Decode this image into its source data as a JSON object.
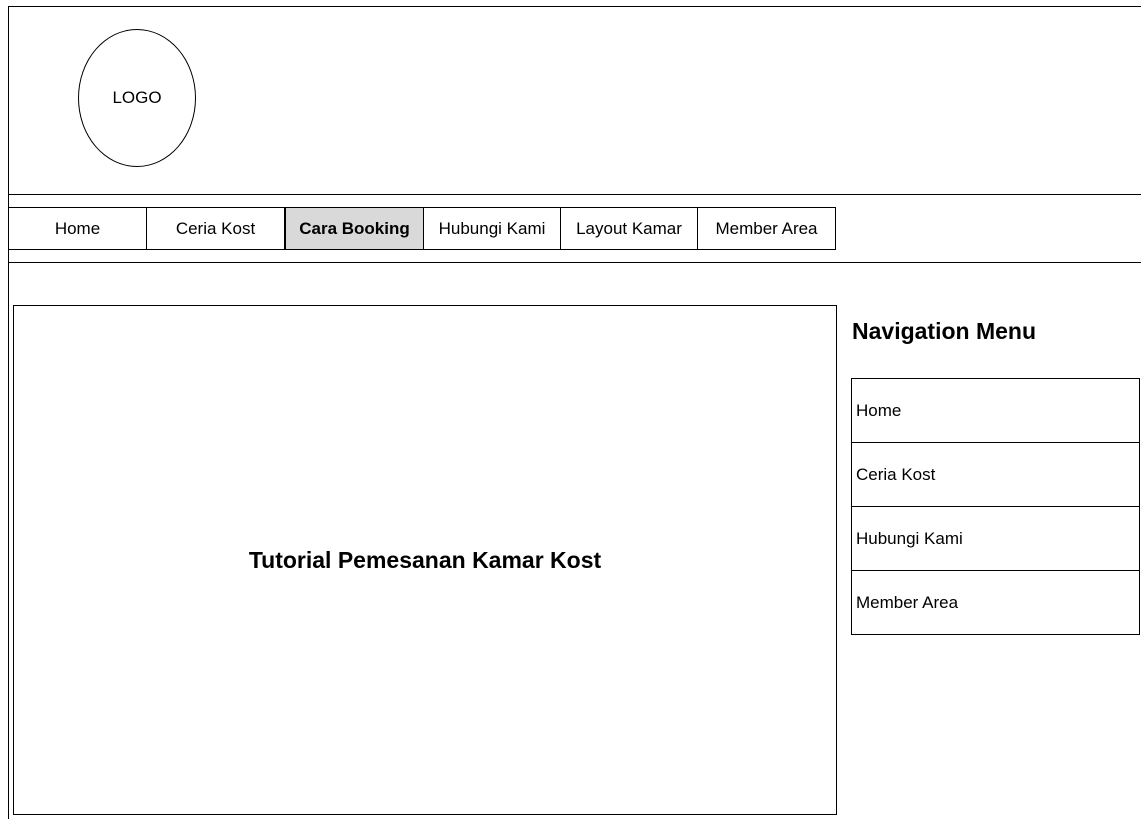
{
  "header": {
    "logo_text": "LOGO"
  },
  "top_nav": {
    "items": [
      {
        "label": "Home",
        "active": false
      },
      {
        "label": "Ceria Kost",
        "active": false
      },
      {
        "label": "Cara Booking",
        "active": true
      },
      {
        "label": "Hubungi Kami",
        "active": false
      },
      {
        "label": "Layout Kamar",
        "active": false
      },
      {
        "label": "Member Area",
        "active": false
      }
    ],
    "active_bg": "#d9d9d9"
  },
  "main": {
    "title": "Tutorial Pemesanan Kamar Kost"
  },
  "sidebar": {
    "title": "Navigation Menu",
    "items": [
      {
        "label": "Home"
      },
      {
        "label": "Ceria Kost"
      },
      {
        "label": "Hubungi Kami"
      },
      {
        "label": "Member Area"
      }
    ]
  }
}
